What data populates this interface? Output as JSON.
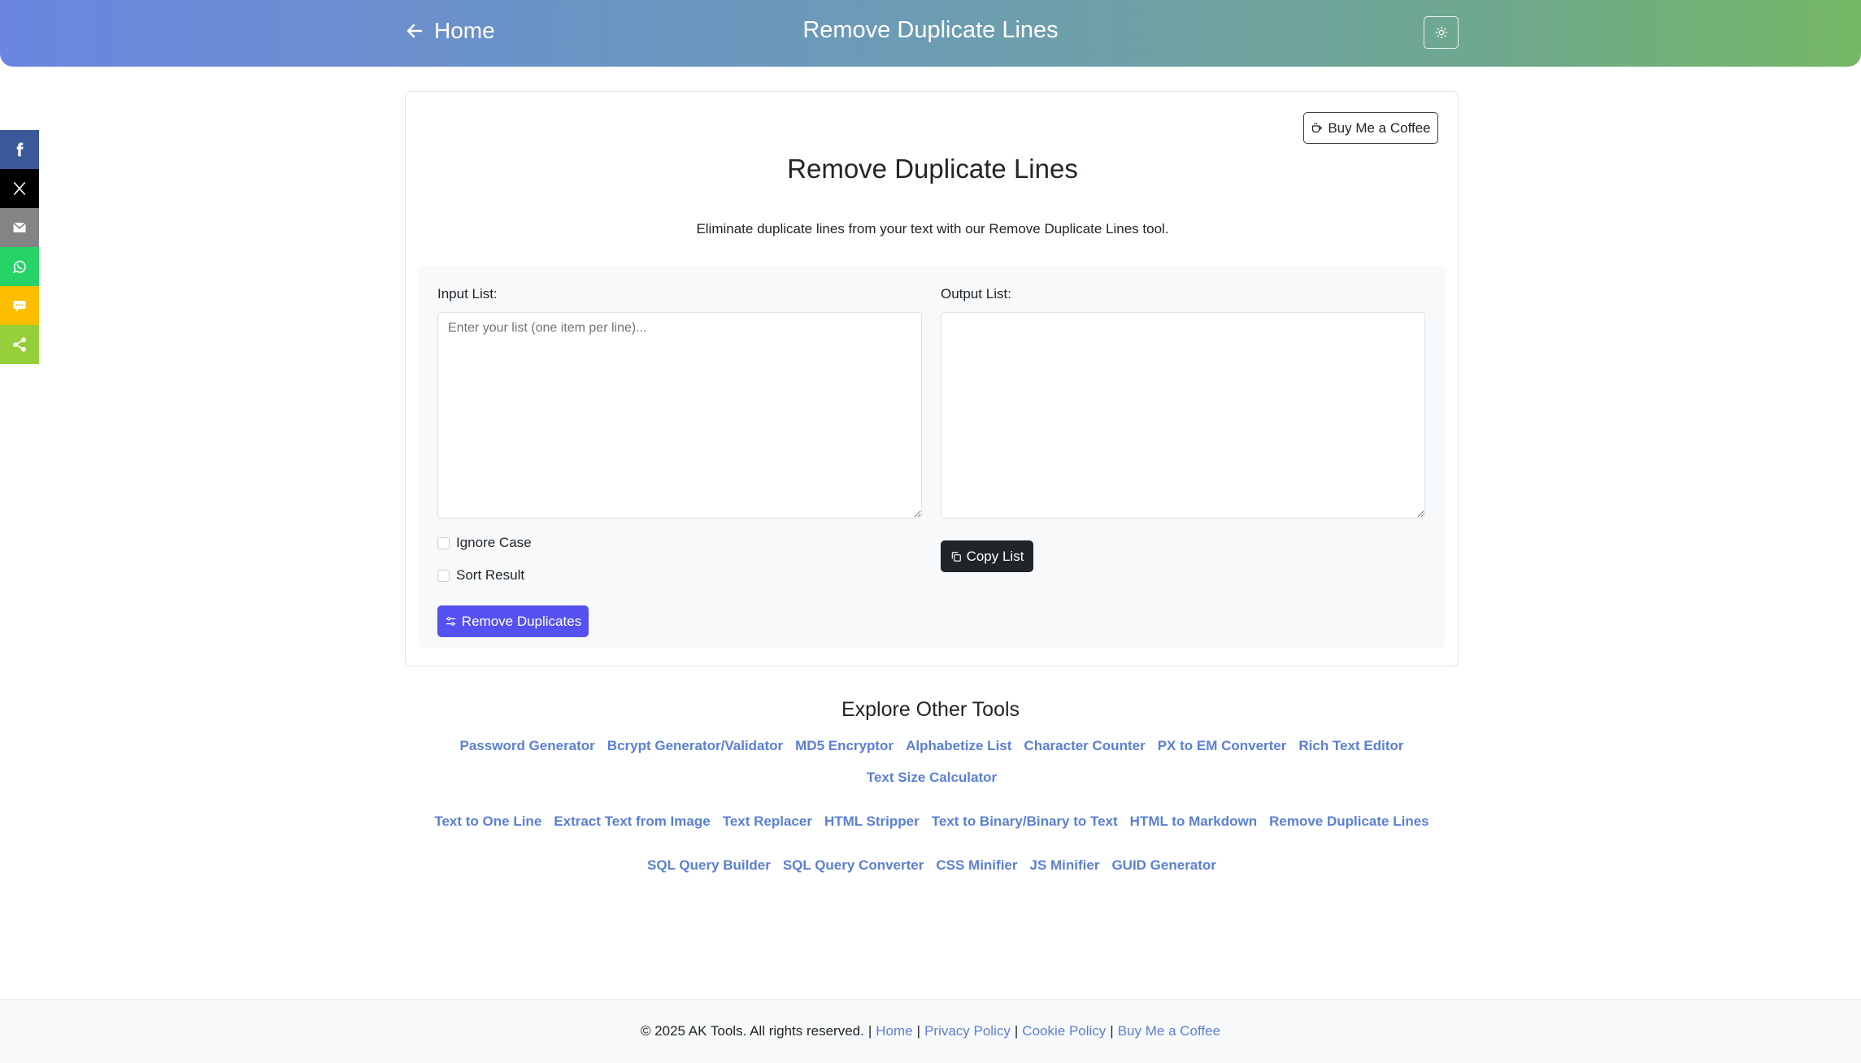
{
  "header": {
    "home_label": "Home",
    "title": "Remove Duplicate Lines",
    "theme_icon": "sun-icon"
  },
  "share_bar": [
    {
      "name": "facebook",
      "icon": "facebook-icon",
      "color": "#3b5998"
    },
    {
      "name": "x",
      "icon": "x-icon",
      "color": "#000000"
    },
    {
      "name": "email",
      "icon": "mail-icon",
      "color": "#848484"
    },
    {
      "name": "whatsapp",
      "icon": "whatsapp-icon",
      "color": "#25d366"
    },
    {
      "name": "sms",
      "icon": "sms-icon",
      "color": "#ffbd00"
    },
    {
      "name": "sharethis",
      "icon": "share-icon",
      "color": "#95d03a"
    }
  ],
  "card": {
    "coffee_label": "Buy Me a Coffee",
    "title": "Remove Duplicate Lines",
    "description": "Eliminate duplicate lines from your text with our Remove Duplicate Lines tool.",
    "input_label": "Input List:",
    "input_placeholder": "Enter your list (one item per line)...",
    "input_value": "",
    "output_label": "Output List:",
    "output_value": "",
    "ignore_case_label": "Ignore Case",
    "ignore_case_checked": false,
    "sort_result_label": "Sort Result",
    "sort_result_checked": false,
    "remove_button_label": "Remove Duplicates",
    "copy_button_label": "Copy List"
  },
  "explore": {
    "title": "Explore Other Tools",
    "rows": [
      [
        "Password Generator",
        "Bcrypt Generator/Validator",
        "MD5 Encryptor",
        "Alphabetize List",
        "Character Counter",
        "PX to EM Converter",
        "Rich Text Editor",
        "Text Size Calculator"
      ],
      [
        "Text to One Line",
        "Extract Text from Image",
        "Text Replacer",
        "HTML Stripper",
        "Text to Binary/Binary to Text",
        "HTML to Markdown",
        "Remove Duplicate Lines"
      ],
      [
        "SQL Query Builder",
        "SQL Query Converter",
        "CSS Minifier",
        "JS Minifier",
        "GUID Generator"
      ]
    ]
  },
  "footer": {
    "copyright": "© 2025 AK Tools. All rights reserved.",
    "separator": "|",
    "links": [
      "Home",
      "Privacy Policy",
      "Cookie Policy",
      "Buy Me a Coffee"
    ]
  },
  "colors": {
    "accent": "#5551f0",
    "link": "#5b7fd6",
    "dark_button": "#212529"
  }
}
